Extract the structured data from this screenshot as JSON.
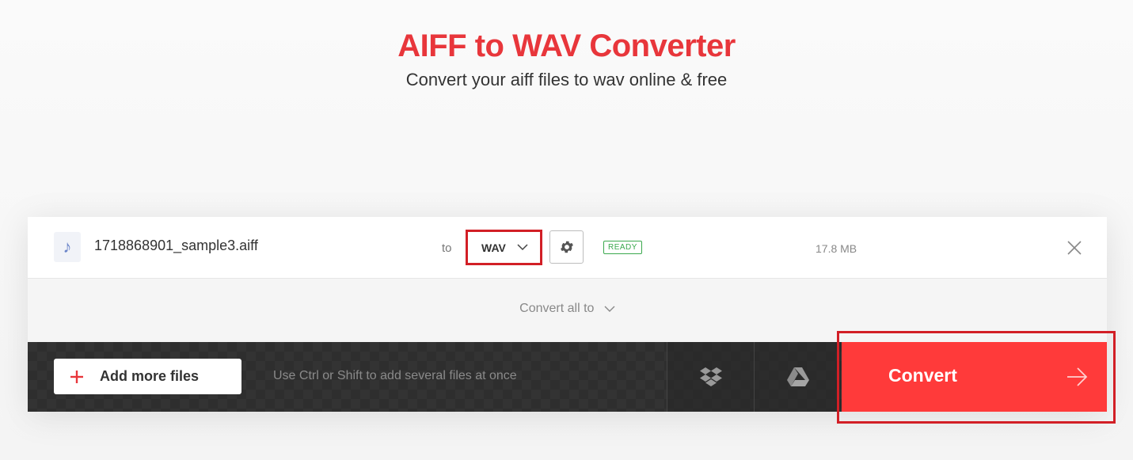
{
  "header": {
    "title": "AIFF to WAV Converter",
    "subtitle": "Convert your aiff files to wav online & free"
  },
  "file": {
    "icon": "music-note-icon",
    "name": "1718868901_sample3.aiff",
    "to_label": "to",
    "format": "WAV",
    "status": "READY",
    "size": "17.8 MB"
  },
  "convert_all": {
    "label": "Convert all to"
  },
  "toolbar": {
    "add_files_label": "Add more files",
    "hint": "Use Ctrl or Shift to add several files at once",
    "convert_label": "Convert"
  },
  "colors": {
    "brand_red": "#e8363b",
    "convert_bg": "#ff3a3a",
    "highlight": "#d21f26",
    "ready_green": "#3aa84d",
    "bar_dark": "#333333"
  }
}
